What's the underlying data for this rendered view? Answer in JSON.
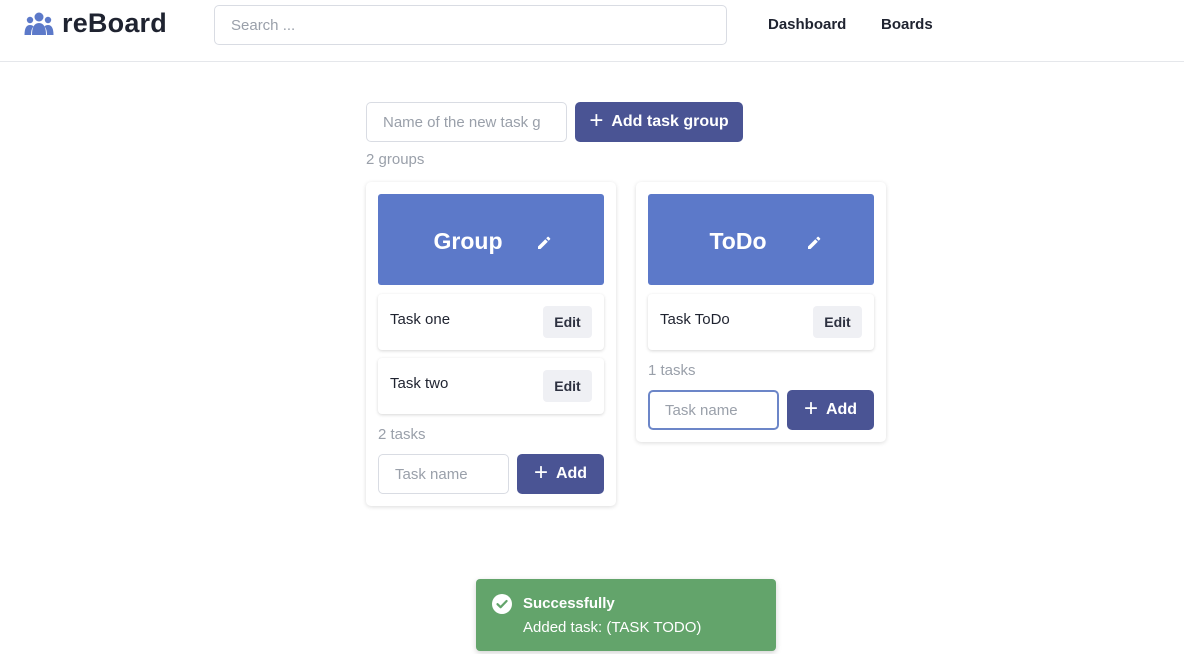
{
  "header": {
    "app_name": "reBoard",
    "search_placeholder": "Search ...",
    "nav": [
      {
        "label": "Dashboard"
      },
      {
        "label": "Boards"
      }
    ]
  },
  "new_group": {
    "input_placeholder": "Name of the new task g",
    "add_button_label": "Add task group",
    "groups_count": "2 groups"
  },
  "groups": [
    {
      "title": "Group",
      "tasks": [
        {
          "name": "Task one",
          "edit_label": "Edit"
        },
        {
          "name": "Task two",
          "edit_label": "Edit"
        }
      ],
      "tasks_count": "2 tasks",
      "task_input_placeholder": "Task name",
      "add_label": "Add"
    },
    {
      "title": "ToDo",
      "tasks": [
        {
          "name": "Task ToDo",
          "edit_label": "Edit"
        }
      ],
      "tasks_count": "1 tasks",
      "task_input_placeholder": "Task name",
      "add_label": "Add"
    }
  ],
  "toast": {
    "title": "Successfully",
    "message": "Added task: (TASK TODO)",
    "icon": "check-circle-icon"
  },
  "colors": {
    "primary": "#4a5494",
    "group_header": "#5c79c9",
    "toast_success": "#63a46b",
    "logo": "#5c79c9"
  }
}
